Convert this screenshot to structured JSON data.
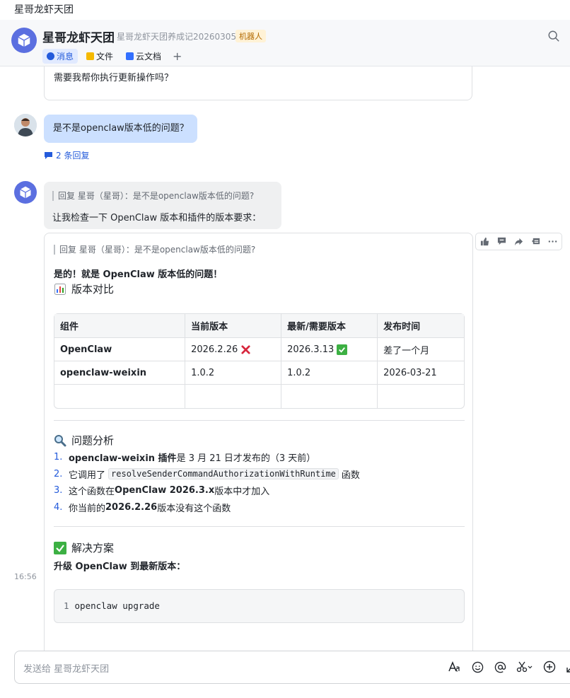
{
  "window": {
    "title": "星哥龙虾天团"
  },
  "header": {
    "group_name": "星哥龙虾天团",
    "subtitle": "星哥龙虾天团养成记20260305",
    "badge": "机器人",
    "tabs": [
      {
        "label": "消息",
        "active": true
      },
      {
        "label": "文件",
        "active": false
      },
      {
        "label": "云文档",
        "active": false
      }
    ],
    "add_tab": "+"
  },
  "messages": {
    "prev_card_text": "需要我帮你执行更新操作吗？",
    "user_question": "是不是openclaw版本低的问题？",
    "reply_count": "2 条回复",
    "bot_reply1": {
      "quote": "回复 星哥（星哥）：是不是openclaw版本低的问题?",
      "text": "让我检查一下 OpenClaw 版本和插件的版本要求："
    },
    "card": {
      "quote": "回复 星哥（星哥）：是不是openclaw版本低的问题?",
      "lead": "是的！就是 OpenClaw 版本低的问题！",
      "section1_title": "版本对比",
      "table": {
        "headers": [
          "组件",
          "当前版本",
          "最新/需要版本",
          "发布时间"
        ],
        "rows": [
          [
            "OpenClaw",
            "2026.2.26",
            "2026.3.13",
            "差了一个月"
          ],
          [
            "openclaw-weixin",
            "1.0.2",
            "1.0.2",
            "2026-03-21"
          ],
          [
            "",
            "",
            "",
            ""
          ]
        ]
      },
      "section2_title": "问题分析",
      "issues": [
        {
          "num": "1.",
          "bold": "openclaw-weixin 插件",
          "text": " 是 3 月 21 日才发布的（3 天前）"
        },
        {
          "num": "2.",
          "pre": "它调用了",
          "code": "resolveSenderCommandAuthorizationWithRuntime",
          "text": "函数"
        },
        {
          "num": "3.",
          "pre": "这个函数在 ",
          "bold": "OpenClaw 2026.3.x",
          "text": " 版本中才加入"
        },
        {
          "num": "4.",
          "pre": "你当前的 ",
          "bold": "2026.2.26",
          "text": " 版本没有这个函数"
        }
      ],
      "section3_title": "解决方案",
      "solution_lead": "升级 OpenClaw 到最新版本：",
      "code_line_num": "1",
      "code_line": "openclaw upgrade"
    },
    "timestamp": "16:56"
  },
  "composer": {
    "placeholder": "发送给 星哥龙虾天团"
  },
  "colors": {
    "accent": "#245bdb",
    "user_bubble": "#cce0ff",
    "bot_avatar": "#5b6fe0"
  }
}
